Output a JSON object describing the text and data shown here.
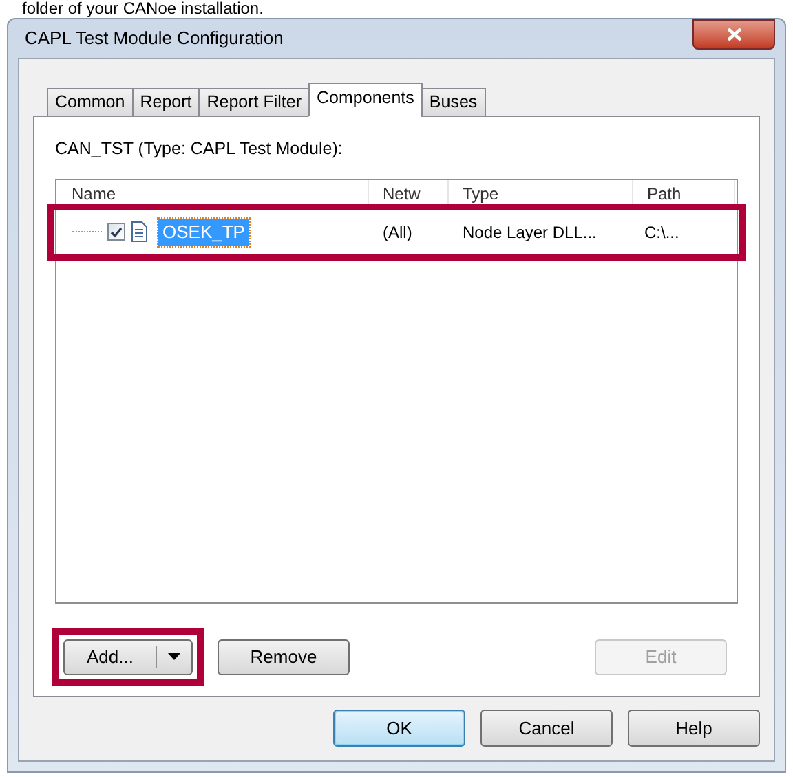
{
  "page_text": "folder of your CANoe installation.",
  "window": {
    "title": "CAPL Test Module Configuration"
  },
  "tabs": [
    {
      "label": "Common",
      "selected": false
    },
    {
      "label": "Report",
      "selected": false
    },
    {
      "label": "Report Filter",
      "selected": false
    },
    {
      "label": "Components",
      "selected": true
    },
    {
      "label": "Buses",
      "selected": false
    }
  ],
  "module_label": "CAN_TST (Type: CAPL Test Module):",
  "table": {
    "columns": [
      "Name",
      "Netw",
      "Type",
      "Path"
    ],
    "rows": [
      {
        "name": "OSEK_TP",
        "network": "(All)",
        "type": "Node Layer DLL...",
        "path": "C:\\...",
        "checked": true,
        "selected": true,
        "highlighted": true
      }
    ]
  },
  "list_buttons": [
    {
      "label": "Add...",
      "kind": "split",
      "disabled": false,
      "highlighted": true
    },
    {
      "label": "Remove",
      "kind": "plain",
      "disabled": false,
      "highlighted": false
    },
    {
      "label": "Edit",
      "kind": "plain",
      "disabled": true,
      "highlighted": false
    }
  ],
  "dialog_buttons": [
    {
      "label": "OK",
      "default": true
    },
    {
      "label": "Cancel",
      "default": false
    },
    {
      "label": "Help",
      "default": false
    }
  ]
}
